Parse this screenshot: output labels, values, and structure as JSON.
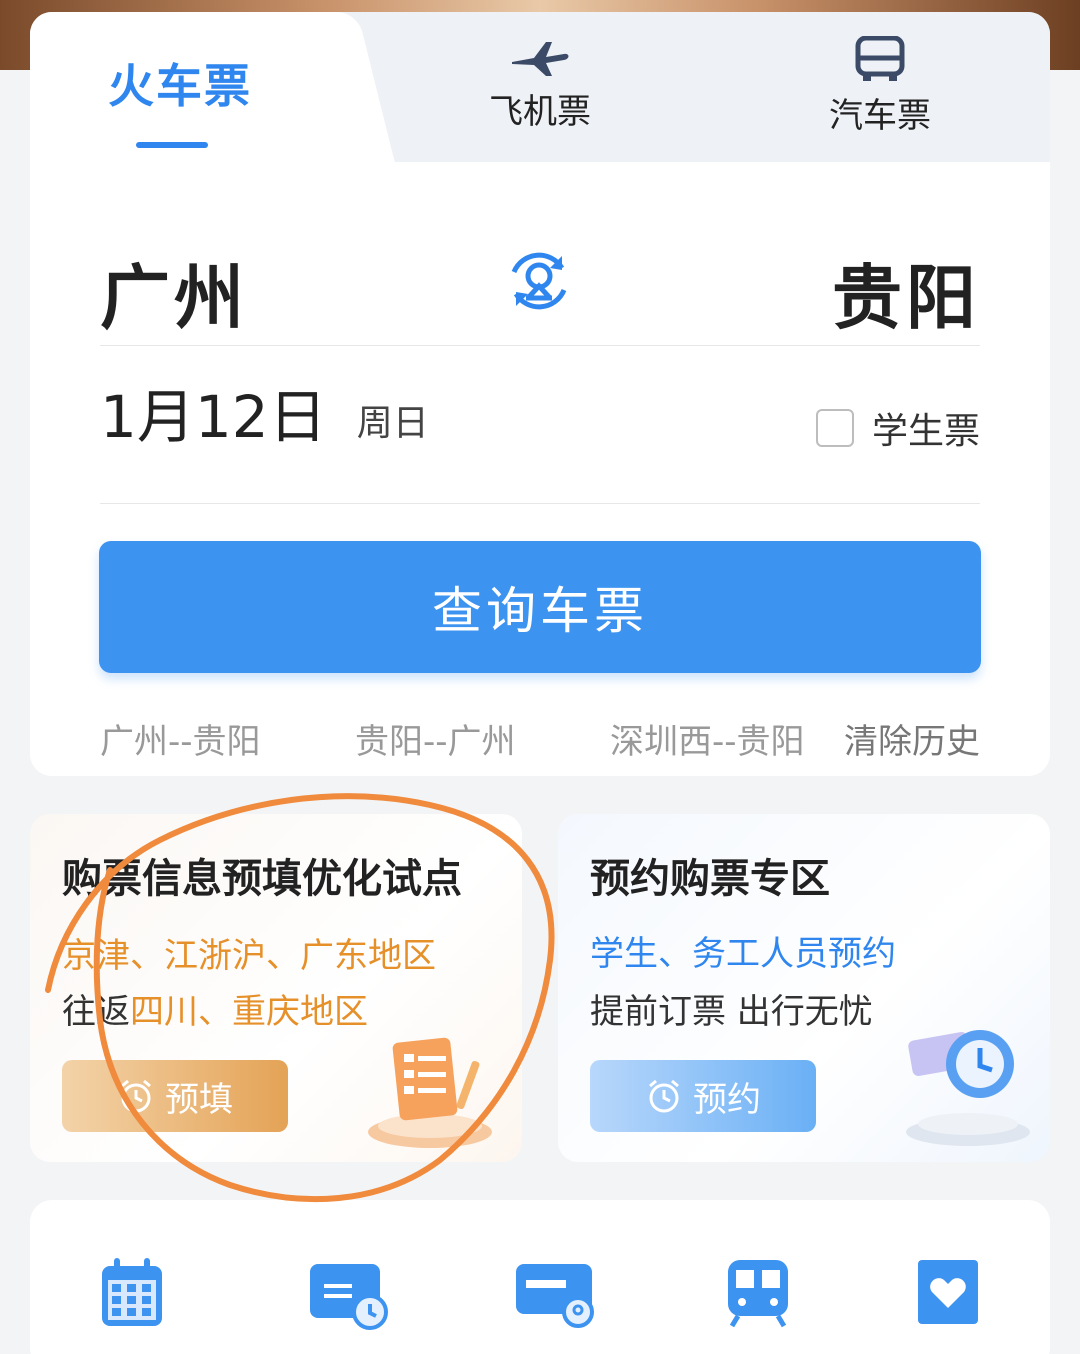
{
  "tabs": [
    {
      "label": "火车票",
      "icon": "train",
      "active": true
    },
    {
      "label": "飞机票",
      "icon": "plane-icon",
      "active": false
    },
    {
      "label": "汽车票",
      "icon": "bus-icon",
      "active": false
    }
  ],
  "route": {
    "from": "广州",
    "to": "贵阳",
    "swap_icon": "swap-icon"
  },
  "date": {
    "value": "1月12日",
    "weekday": "周日"
  },
  "student": {
    "label": "学生票",
    "checked": false
  },
  "search_button": "查询车票",
  "history": [
    "广州--贵阳",
    "贵阳--广州",
    "深圳西--贵阳"
  ],
  "clear_history": "清除历史",
  "promo_left": {
    "title": "购票信息预填优化试点",
    "line1": "京津、江浙沪、广东地区",
    "line2_prefix": "往返",
    "line2_highlight": "四川、重庆地区",
    "button": "预填",
    "button_icon": "alarm-clock-icon"
  },
  "promo_right": {
    "title": "预约购票专区",
    "line1": "学生、务工人员预约",
    "line2": "提前订票 出行无忧",
    "button": "预约",
    "button_icon": "alarm-clock-icon"
  },
  "quick_icons": [
    "calendar-icon",
    "transfer-ticket-icon",
    "card-icon",
    "train-icon",
    "favorite-icon"
  ],
  "colors": {
    "accent": "#2f86ee",
    "button": "#3d93f0",
    "orange": "#e6902a",
    "annotation": "#f08a3c"
  }
}
